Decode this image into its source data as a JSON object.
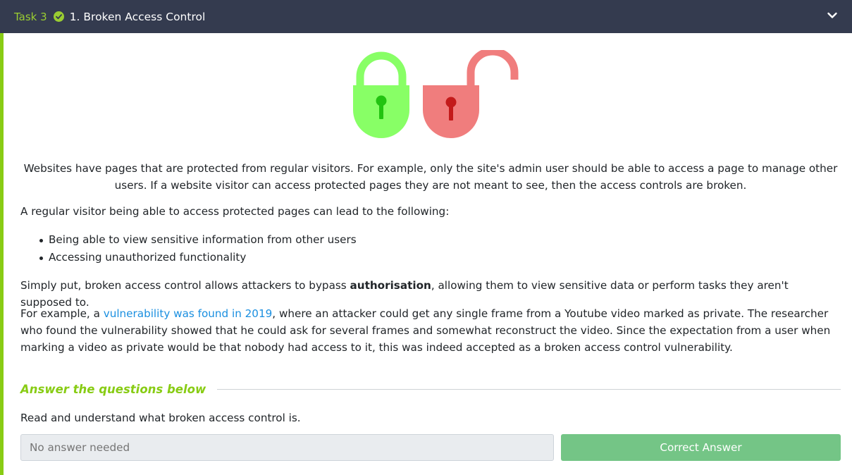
{
  "header": {
    "task_label": "Task 3",
    "title": "1. Broken Access Control"
  },
  "content": {
    "intro": "Websites have pages that are protected from regular visitors. For example, only the site's admin user should be able to access a page to manage other users. If a website visitor can access protected pages they are not meant to see, then the access controls are broken.",
    "lead": "A regular visitor being able to access protected pages can lead to the following:",
    "bullets": [
      "Being able to view sensitive information from other users",
      "Accessing unauthorized functionality"
    ],
    "summary_before": "Simply put, broken access control allows attackers to bypass ",
    "summary_bold": "authorisation",
    "summary_after": ", allowing them to view sensitive data or perform tasks they aren't supposed to.",
    "example_before": "For example, a ",
    "example_link": "vulnerability was found in 2019",
    "example_after": ", where an attacker could get any single frame from a Youtube video marked as private. The researcher who found the vulnerability showed that he could ask for several frames and somewhat reconstruct the video. Since the expectation from a user when marking a video as private would be that nobody had access to it, this was indeed accepted as a broken access control vulnerability."
  },
  "answers": {
    "heading": "Answer the questions below",
    "question": "Read and understand what broken access control is.",
    "input_placeholder": "No answer needed",
    "button_label": "Correct Answer"
  },
  "icons": {
    "check": "check-circle-icon",
    "chevron": "chevron-down-icon",
    "locked": "padlock-locked-icon",
    "unlocked": "padlock-unlocked-icon"
  },
  "colors": {
    "header_bg": "#343b4f",
    "accent": "#88cc14",
    "lock_green": "#88ff66",
    "lock_red": "#f07d7d",
    "link": "#1a8fe0",
    "button": "#74c586"
  }
}
